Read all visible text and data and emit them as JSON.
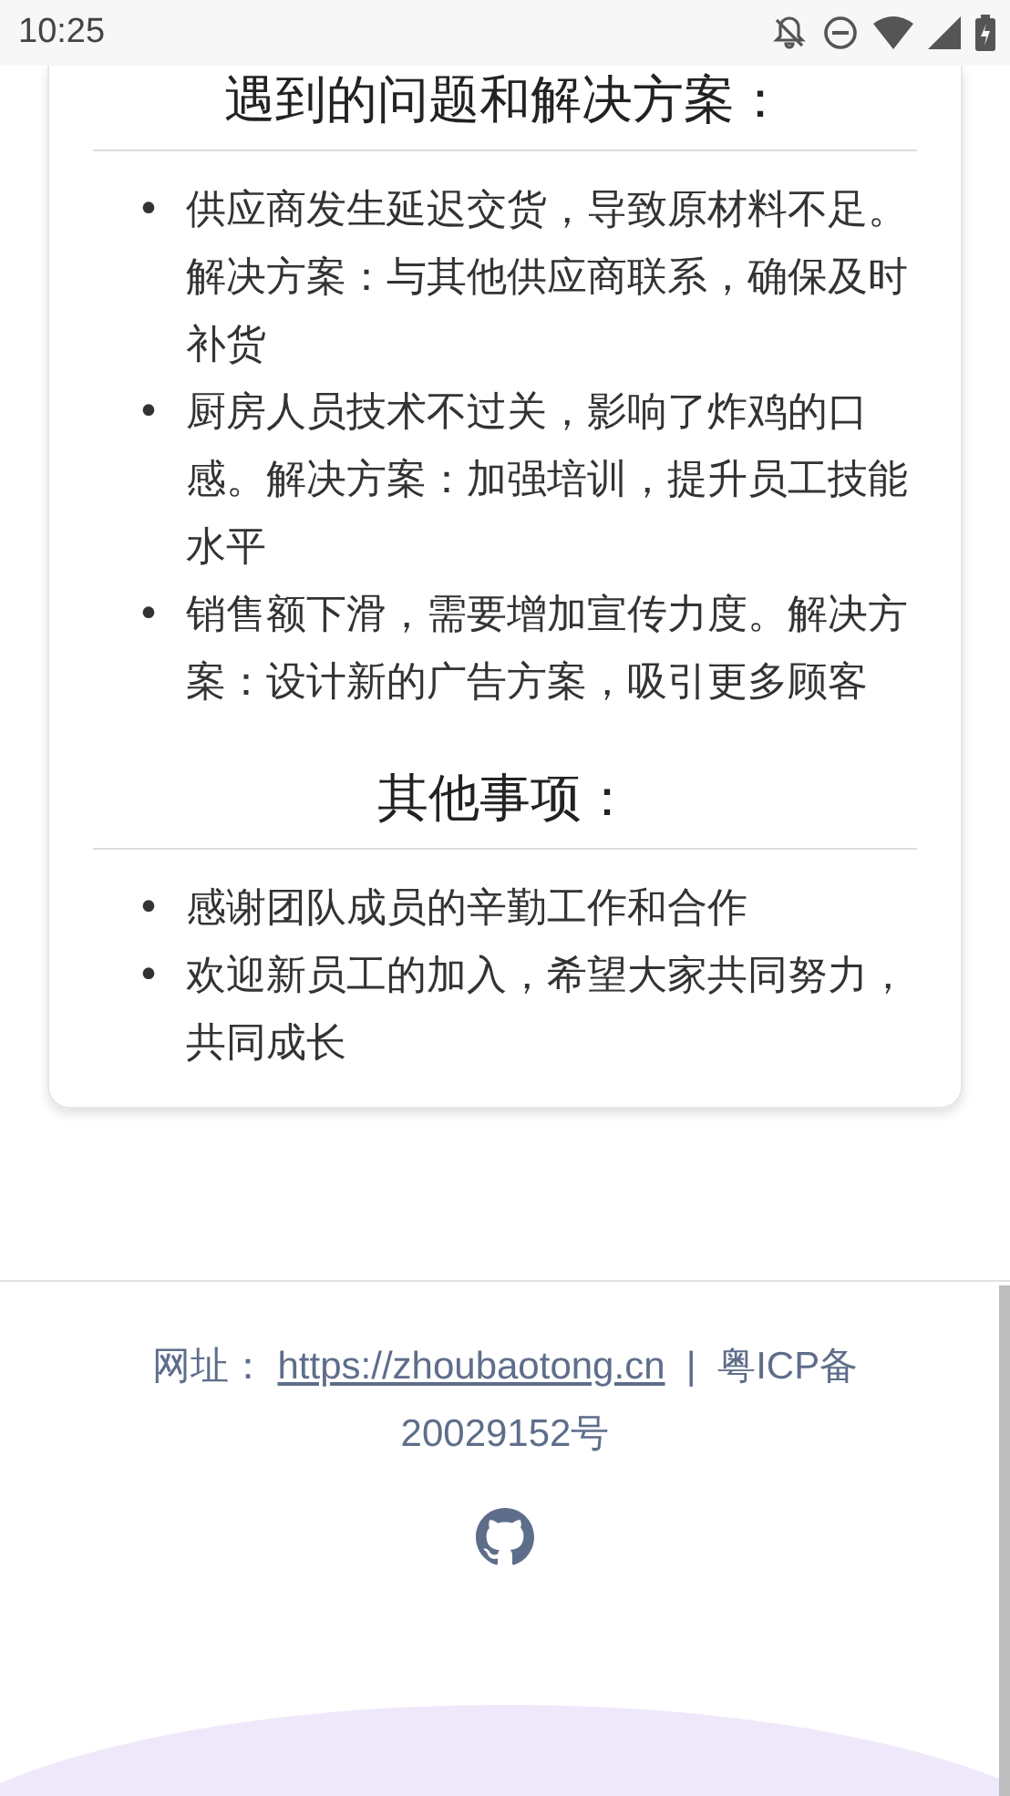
{
  "status_bar": {
    "time": "10:25"
  },
  "bullet": "•",
  "sections": [
    {
      "heading": "遇到的问题和解决方案：",
      "items": [
        "供应商发生延迟交货，导致原材料不足。解决方案：与其他供应商联系，确保及时补货",
        "厨房人员技术不过关，影响了炸鸡的口感。解决方案：加强培训，提升员工技能水平",
        "销售额下滑，需要增加宣传力度。解决方案：设计新的广告方案，吸引更多顾客"
      ]
    },
    {
      "heading": "其他事项：",
      "items": [
        "感谢团队成员的辛勤工作和合作",
        "欢迎新员工的加入，希望大家共同努力，共同成长"
      ]
    }
  ],
  "footer": {
    "label": "网址：",
    "link": "https://zhoubaotong.cn",
    "separator": "|",
    "record": "粤ICP备20029152号"
  }
}
